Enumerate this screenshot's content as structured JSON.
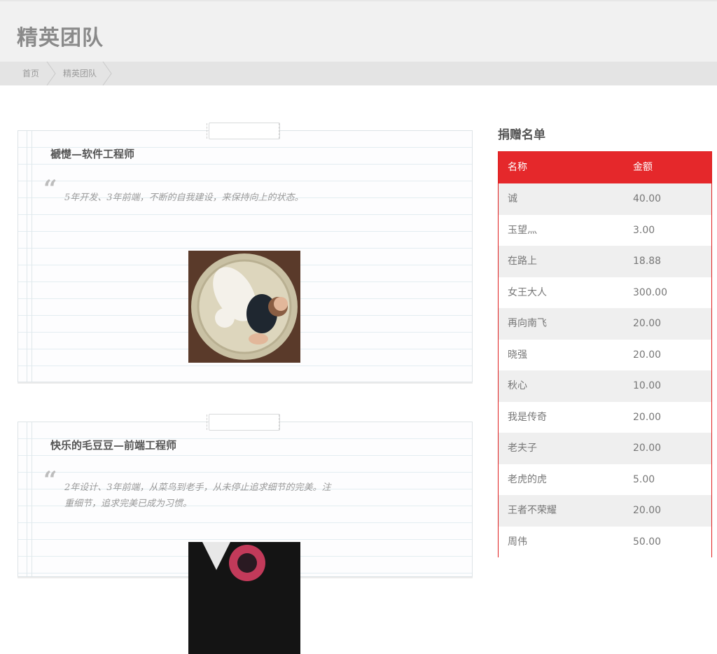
{
  "page": {
    "title": "精英团队"
  },
  "breadcrumb": {
    "items": [
      "首页",
      "精英团队"
    ]
  },
  "members": [
    {
      "title": "褫憷—软件工程师",
      "quote": "5年开发、3年前端，不断的自我建设，来保持向上的状态。"
    },
    {
      "title": "快乐的毛豆豆—前端工程师",
      "quote": "2年设计、3年前端，从菜鸟到老手，从未停止追求细节的完美。注重细节，追求完美已成为习惯。"
    }
  ],
  "donations": {
    "title": "捐赠名单",
    "columns": [
      "名称",
      "金额"
    ],
    "rows": [
      {
        "name": "诚",
        "amount": "40.00"
      },
      {
        "name": "玉望灬",
        "amount": "3.00"
      },
      {
        "name": "在路上",
        "amount": "18.88"
      },
      {
        "name": "女王大人",
        "amount": "300.00"
      },
      {
        "name": "再向南飞",
        "amount": "20.00"
      },
      {
        "name": "晓强",
        "amount": "20.00"
      },
      {
        "name": "秋心",
        "amount": "10.00"
      },
      {
        "name": "我是传奇",
        "amount": "20.00"
      },
      {
        "name": "老夫子",
        "amount": "20.00"
      },
      {
        "name": "老虎的虎",
        "amount": "5.00"
      },
      {
        "name": "王者不荣耀",
        "amount": "20.00"
      },
      {
        "name": "周伟",
        "amount": "50.00"
      }
    ]
  },
  "colors": {
    "accent": "#e5282b",
    "row_alt": "#efefef",
    "header_bg": "#f1f1f1"
  }
}
